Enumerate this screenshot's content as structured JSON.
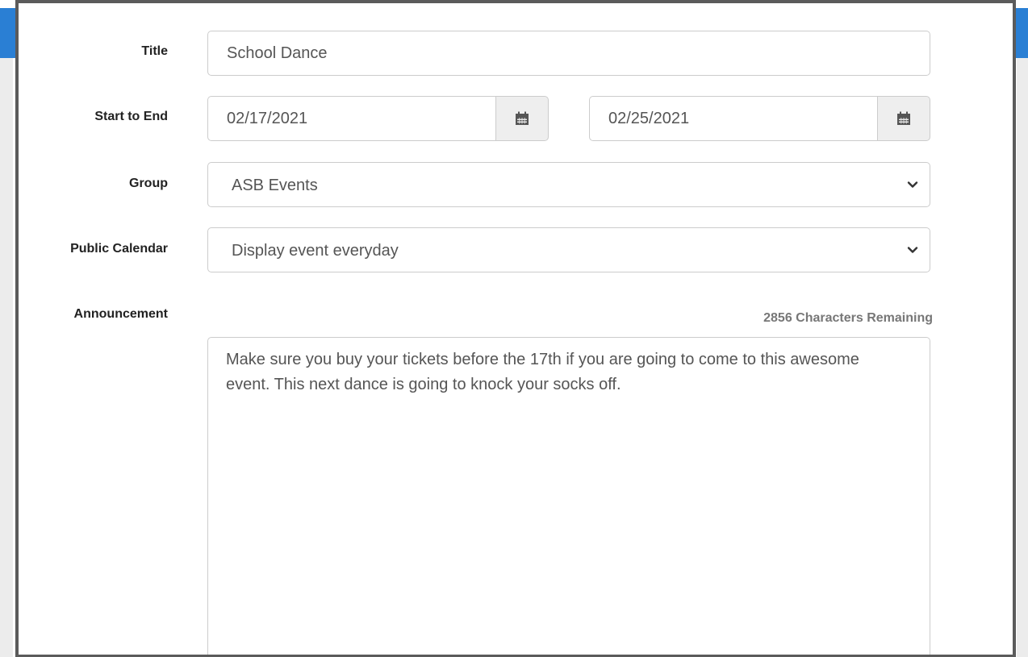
{
  "theme": {
    "header_blue": "#2a7fd4",
    "frame_gray": "#5b5b5b",
    "input_border": "#cccccc",
    "addon_bg": "#eeeeee"
  },
  "form": {
    "title": {
      "label": "Title",
      "value": "School Dance"
    },
    "dates": {
      "label": "Start to End",
      "start_value": "02/17/2021",
      "end_value": "02/25/2021",
      "icon": "calendar-icon"
    },
    "group": {
      "label": "Group",
      "selected": "ASB Events",
      "icon": "chevron-down-icon"
    },
    "public_calendar": {
      "label": "Public Calendar",
      "selected": "Display event everyday",
      "icon": "chevron-down-icon"
    },
    "announcement": {
      "label": "Announcement",
      "counter": "2856 Characters Remaining",
      "value": "Make sure you buy your tickets before the 17th if you are going to come to this awesome event. This next dance is going to knock your socks off."
    }
  }
}
